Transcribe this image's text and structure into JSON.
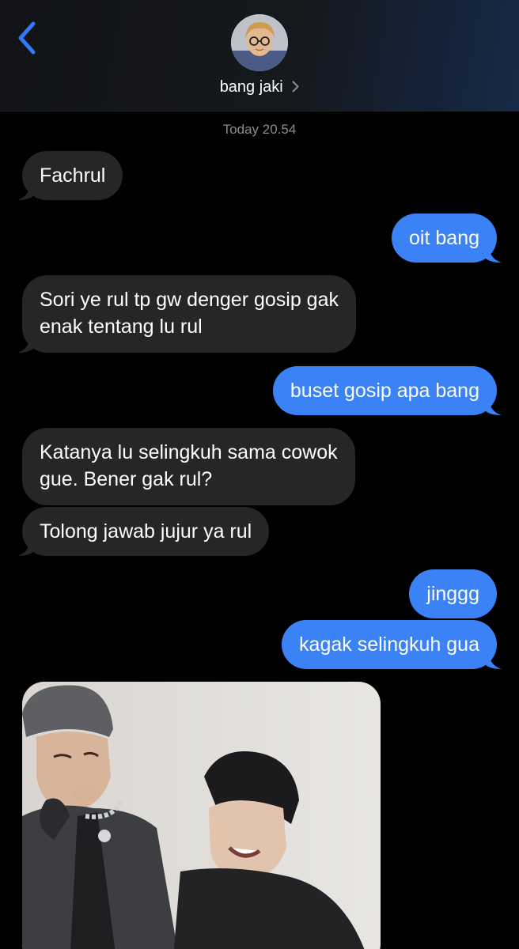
{
  "header": {
    "contact_name": "bang jaki"
  },
  "thread": {
    "timestamp": "Today 20.54",
    "messages": [
      {
        "direction": "incoming",
        "text": "Fachrul"
      },
      {
        "direction": "outgoing",
        "text": "oit bang"
      },
      {
        "direction": "incoming",
        "text": "Sori ye rul tp gw denger gosip gak",
        "text_line2": "enak tentang lu rul"
      },
      {
        "direction": "outgoing",
        "text": "buset gosip apa bang"
      },
      {
        "direction": "incoming",
        "text": "Katanya lu selingkuh sama cowok",
        "text_line2": "gue. Bener gak rul?"
      },
      {
        "direction": "incoming",
        "text": "Tolong jawab jujur ya rul"
      },
      {
        "direction": "outgoing",
        "text": "jinggg"
      },
      {
        "direction": "outgoing",
        "text": "kagak selingkuh gua"
      }
    ]
  },
  "colors": {
    "background": "#000000",
    "incoming_bubble": "#262628",
    "outgoing_bubble": "#3a82f6",
    "accent": "#2f7cf6",
    "timestamp_text": "#8b8b90"
  }
}
